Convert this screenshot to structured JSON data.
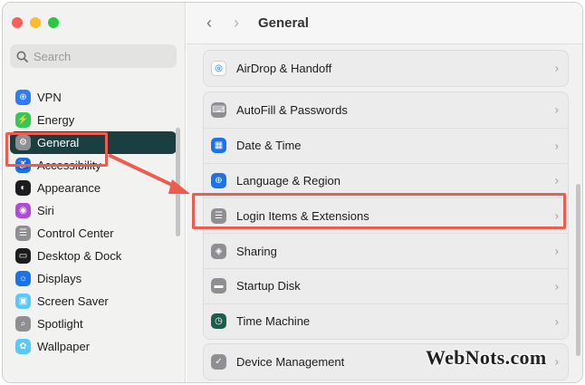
{
  "window": {
    "traffic_lights": [
      {
        "name": "close-button",
        "color": "#fe5f57"
      },
      {
        "name": "minimize-button",
        "color": "#febc2e"
      },
      {
        "name": "maximize-button",
        "color": "#28c840"
      }
    ]
  },
  "sidebar": {
    "search_placeholder": "Search",
    "items": [
      {
        "label": "VPN",
        "icon": "globe-icon",
        "color": "#2f7cf6",
        "glyph": "⊕"
      },
      {
        "label": "Energy",
        "icon": "battery-icon",
        "color": "#34c759",
        "glyph": "⚡"
      },
      {
        "label": "General",
        "icon": "gear-icon",
        "color": "#8e8e93",
        "glyph": "⚙",
        "selected": true
      },
      {
        "label": "Accessibility",
        "icon": "accessibility-icon",
        "color": "#1a73e8",
        "glyph": "♿"
      },
      {
        "label": "Appearance",
        "icon": "appearance-icon",
        "color": "#1c1c1e",
        "glyph": "◐"
      },
      {
        "label": "Siri",
        "icon": "siri-icon",
        "color": "#b04ad9",
        "glyph": "◉"
      },
      {
        "label": "Control Center",
        "icon": "control-center-icon",
        "color": "#8e8e93",
        "glyph": "☰"
      },
      {
        "label": "Desktop & Dock",
        "icon": "dock-icon",
        "color": "#1c1c1e",
        "glyph": "▭"
      },
      {
        "label": "Displays",
        "icon": "display-icon",
        "color": "#1a73e8",
        "glyph": "☼"
      },
      {
        "label": "Screen Saver",
        "icon": "screen-saver-icon",
        "color": "#5ac8fa",
        "glyph": "▣"
      },
      {
        "label": "Spotlight",
        "icon": "spotlight-icon",
        "color": "#8e8e93",
        "glyph": "⌕"
      },
      {
        "label": "Wallpaper",
        "icon": "wallpaper-icon",
        "color": "#5ac8fa",
        "glyph": "✿"
      }
    ]
  },
  "toolbar": {
    "back": "‹",
    "forward": "›",
    "title": "General"
  },
  "main": {
    "groups": [
      [
        {
          "label": "AirDrop & Handoff",
          "icon": "airdrop-icon",
          "color": "#ffffff",
          "glyph": "◎",
          "glyph_color": "#1a73e8"
        }
      ],
      [
        {
          "label": "AutoFill & Passwords",
          "icon": "autofill-icon",
          "color": "#8e8e93",
          "glyph": "⌨"
        },
        {
          "label": "Date & Time",
          "icon": "calendar-icon",
          "color": "#1a73e8",
          "glyph": "▦"
        },
        {
          "label": "Language & Region",
          "icon": "language-icon",
          "color": "#1a73e8",
          "glyph": "⊕"
        },
        {
          "label": "Login Items & Extensions",
          "icon": "login-items-icon",
          "color": "#8e8e93",
          "glyph": "☰",
          "highlighted": true
        },
        {
          "label": "Sharing",
          "icon": "sharing-icon",
          "color": "#8e8e93",
          "glyph": "◈"
        },
        {
          "label": "Startup Disk",
          "icon": "disk-icon",
          "color": "#8e8e93",
          "glyph": "▬"
        },
        {
          "label": "Time Machine",
          "icon": "time-machine-icon",
          "color": "#1c5d4c",
          "glyph": "◷"
        }
      ],
      [
        {
          "label": "Device Management",
          "icon": "device-management-icon",
          "color": "#8e8e93",
          "glyph": "✓"
        }
      ]
    ],
    "chevron": "›"
  },
  "annotation": {
    "color": "#ec5d50"
  },
  "watermark": "WebNots.com"
}
